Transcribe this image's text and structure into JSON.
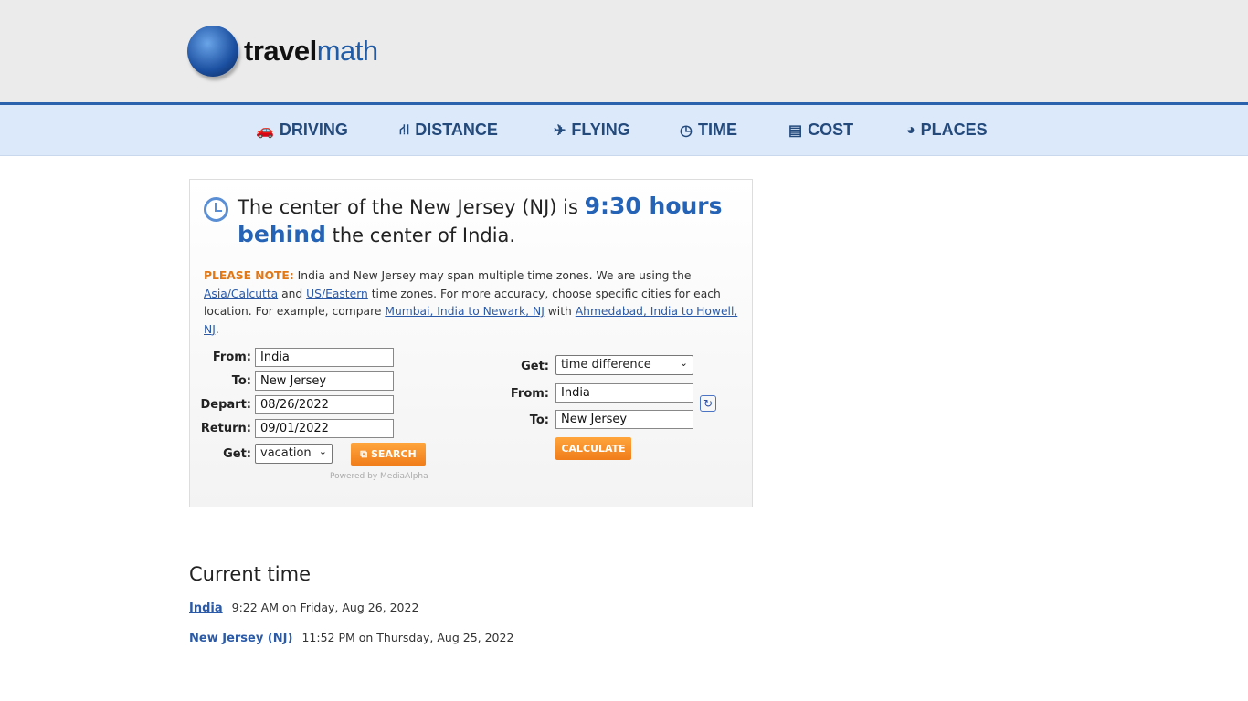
{
  "logo": {
    "text_bold": "travel",
    "text_light": "math"
  },
  "nav": [
    {
      "icon": "car-icon",
      "glyph": "🚗",
      "label": "DRIVING"
    },
    {
      "icon": "road-icon",
      "glyph": "⛙",
      "label": "DISTANCE"
    },
    {
      "icon": "plane-icon",
      "glyph": "✈",
      "label": "FLYING"
    },
    {
      "icon": "clock-icon",
      "glyph": "◷",
      "label": "TIME"
    },
    {
      "icon": "credit-card-icon",
      "glyph": "▤",
      "label": "COST"
    },
    {
      "icon": "globe-icon",
      "glyph": "◕",
      "label": "PLACES"
    }
  ],
  "result": {
    "pre": "The center of the New Jersey (NJ) is ",
    "highlight": "9:30 hours behind",
    "post": " the center of India."
  },
  "note": {
    "label": "PLEASE NOTE:",
    "t1": " India and New Jersey may span multiple time zones. We are using the ",
    "link1": "Asia/Calcutta",
    "t2": " and ",
    "link2": "US/Eastern",
    "t3": " time zones. For more accuracy, choose specific cities for each location. For example, compare ",
    "link3": "Mumbai, India to Newark, NJ",
    "t4": " with ",
    "link4": "Ahmedabad, India to Howell, NJ",
    "t5": "."
  },
  "vacation_form": {
    "from_label": "From:",
    "from": "India",
    "to_label": "To:",
    "to": "New Jersey",
    "depart_label": "Depart:",
    "depart": "08/26/2022",
    "return_label": "Return:",
    "return": "09/01/2022",
    "get_label": "Get:",
    "get": "vacation",
    "search": "SEARCH",
    "powered": "Powered by MediaAlpha"
  },
  "calc_form": {
    "get_label": "Get:",
    "get": "time difference",
    "from_label": "From:",
    "from": "India",
    "to_label": "To:",
    "to": "New Jersey",
    "calculate": "CALCULATE"
  },
  "current_time": {
    "title": "Current time",
    "rows": [
      {
        "place": "India",
        "time": "9:22 AM on Friday, Aug 26, 2022"
      },
      {
        "place": "New Jersey (NJ)",
        "time": "11:52 PM on Thursday, Aug 25, 2022"
      }
    ]
  }
}
